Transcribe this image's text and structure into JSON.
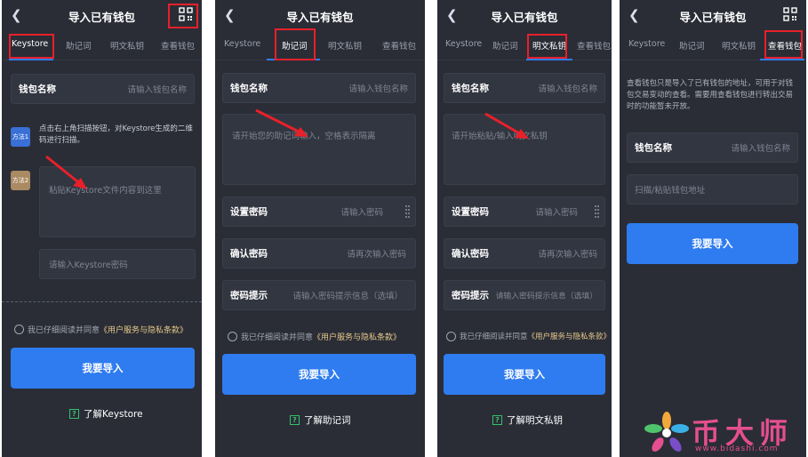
{
  "screens": [
    {
      "title": "导入已有钱包",
      "back_icon": "chevron-left",
      "tabs": [
        "Keystore",
        "助记词",
        "明文私钥",
        "查看钱包"
      ],
      "active_tab": "Keystore",
      "wallet_name_label": "钱包名称",
      "wallet_name_placeholder": "请输入钱包名称",
      "method1_label": "方法1",
      "method1_desc": "点击右上角扫描按钮，对Keystore生成的二维码进行扫描。",
      "method2_label": "方法2",
      "keystore_placeholder": "粘贴Keystore文件内容到这里",
      "password_placeholder": "请输入Keystore密码",
      "agree_prefix": "我已仔细阅读并同意",
      "agree_link": "《用户服务与隐私条款》",
      "submit": "我要导入",
      "learn": "了解Keystore"
    },
    {
      "title": "导入已有钱包",
      "tabs": [
        "Keystore",
        "助记词",
        "明文私钥",
        "查看钱包"
      ],
      "active_tab": "助记词",
      "wallet_name_label": "钱包名称",
      "wallet_name_placeholder": "请输入钱包名称",
      "mnemonic_placeholder": "请开始您的助记词输入，空格表示隔离",
      "set_password_label": "设置密码",
      "set_password_placeholder": "请输入密码",
      "confirm_password_label": "确认密码",
      "confirm_password_placeholder": "请再次输入密码",
      "hint_label": "密码提示",
      "hint_placeholder": "请输入密码提示信息（选填）",
      "agree_prefix": "我已仔细阅读并同意",
      "agree_link": "《用户服务与隐私条款》",
      "submit": "我要导入",
      "learn": "了解助记词"
    },
    {
      "title": "导入已有钱包",
      "tabs": [
        "Keystore",
        "助记词",
        "明文私钥",
        "查看钱包"
      ],
      "active_tab": "明文私钥",
      "wallet_name_label": "钱包名称",
      "wallet_name_placeholder": "请输入钱包名称",
      "privkey_placeholder": "请开始粘贴/输入明文私钥",
      "set_password_label": "设置密码",
      "set_password_placeholder": "请输入密码",
      "confirm_password_label": "确认密码",
      "confirm_password_placeholder": "请再次输入密码",
      "hint_label": "密码提示",
      "hint_placeholder": "请输入密码提示信息（选填）",
      "agree_prefix": "我已仔细阅读并同意",
      "agree_link": "《用户服务与隐私条款》",
      "submit": "我要导入",
      "learn": "了解明文私钥"
    },
    {
      "title": "导入已有钱包",
      "tabs": [
        "Keystore",
        "助记词",
        "明文私钥",
        "查看钱包"
      ],
      "active_tab": "查看钱包",
      "notice": "查看钱包只是导入了已有钱包的地址，可用于对钱包交易变动的查看。需要用查看钱包进行转出交易时的功能暂未开放。",
      "wallet_name_label": "钱包名称",
      "wallet_name_placeholder": "请输入钱包名称",
      "address_placeholder": "扫描/粘贴钱包地址",
      "submit": "我要导入"
    }
  ],
  "watermark": {
    "text": "币大师",
    "url": "www.bidashi.com"
  },
  "colors": {
    "background": "#2a2d36",
    "accent": "#2f7cf0",
    "annotation": "#e8202a",
    "link": "#e6c88a"
  }
}
